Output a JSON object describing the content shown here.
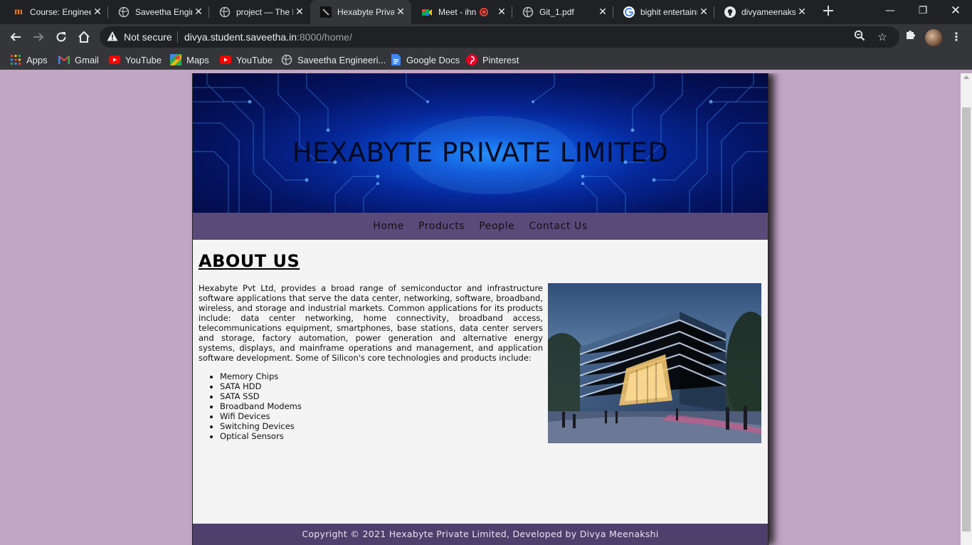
{
  "browser": {
    "tabs": [
      {
        "title": "Course: Engineering",
        "icon": "moodle-icon"
      },
      {
        "title": "Saveetha Engineering",
        "icon": "globe-icon"
      },
      {
        "title": "project — The Bootstrap",
        "icon": "globe-icon"
      },
      {
        "title": "Hexabyte Private Limited",
        "icon": "site-icon"
      },
      {
        "title": "Meet - ihn",
        "icon": "meet-icon"
      },
      {
        "title": "Git_1.pdf",
        "icon": "globe-icon"
      },
      {
        "title": "bighit entertainment",
        "icon": "google-icon"
      },
      {
        "title": "divyameenakshi",
        "icon": "github-icon"
      }
    ],
    "not_secure_label": "Not secure",
    "url_host": "divya.student.saveetha.in",
    "url_rest": ":8000/home/",
    "bookmarks": [
      {
        "label": "Apps"
      },
      {
        "label": "Gmail"
      },
      {
        "label": "YouTube"
      },
      {
        "label": "Maps"
      },
      {
        "label": "YouTube"
      },
      {
        "label": "Saveetha Engineeri..."
      },
      {
        "label": "Google Docs"
      },
      {
        "label": "Pinterest"
      }
    ]
  },
  "site": {
    "title": "HEXABYTE PRIVATE LIMITED",
    "nav": [
      {
        "label": "Home"
      },
      {
        "label": "Products"
      },
      {
        "label": "People"
      },
      {
        "label": "Contact Us"
      }
    ],
    "about_heading": "ABOUT US",
    "about_text": "Hexabyte Pvt Ltd, provides a broad range of semiconductor and infrastructure software applications that serve the data center, networking, software, broadband, wireless, and storage and industrial markets. Common applications for its products include: data center networking, home connectivity, broadband access, telecommunications equipment, smartphones, base stations, data center servers and storage, factory automation, power generation and alternative energy systems, displays, and mainframe operations and management, and application software development. Some of Silicon's core technologies and products include:",
    "products": [
      "Memory Chips",
      "SATA HDD",
      "SATA SSD",
      "Broadband Modems",
      "Wifi Devices",
      "Switching Devices",
      "Optical Sensors"
    ],
    "footer": "Copyright © 2021 Hexabyte Private Limited, Developed by Divya Meenakshi"
  }
}
